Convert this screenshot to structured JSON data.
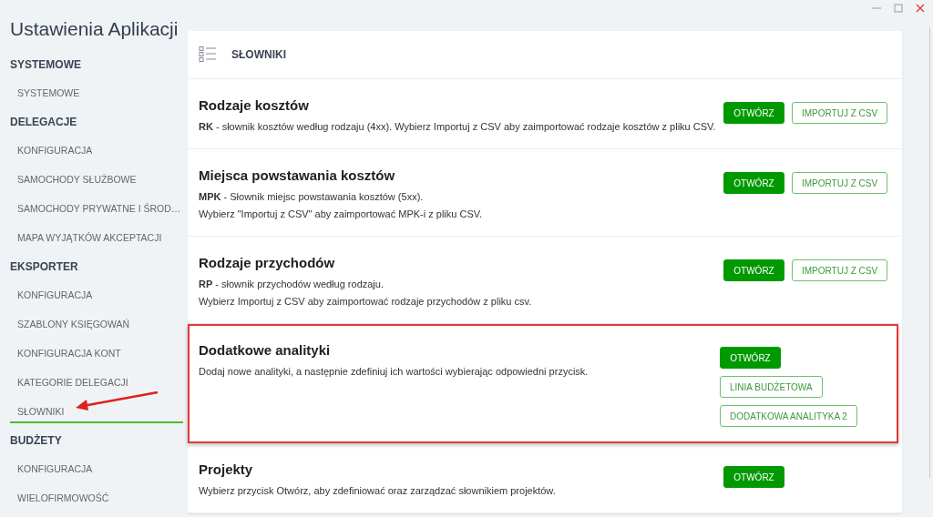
{
  "window": {
    "title": "Ustawienia Aplikacji"
  },
  "sidebar": {
    "groups": [
      {
        "label": "SYSTEMOWE",
        "items": [
          {
            "label": "SYSTEMOWE",
            "selected": false,
            "pointer": false
          }
        ]
      },
      {
        "label": "DELEGACJE",
        "items": [
          {
            "label": "KONFIGURACJA",
            "selected": false,
            "pointer": false
          },
          {
            "label": "SAMOCHODY SŁUŻBOWE",
            "selected": false,
            "pointer": false
          },
          {
            "label": "SAMOCHODY PRYWATNE I ŚROD…",
            "selected": false,
            "pointer": false
          },
          {
            "label": "MAPA WYJĄTKÓW AKCEPTACJI",
            "selected": false,
            "pointer": false
          }
        ]
      },
      {
        "label": "EKSPORTER",
        "items": [
          {
            "label": "KONFIGURACJA",
            "selected": false,
            "pointer": false
          },
          {
            "label": "SZABLONY KSIĘGOWAŃ",
            "selected": false,
            "pointer": false
          },
          {
            "label": "KONFIGURACJA KONT",
            "selected": false,
            "pointer": false
          },
          {
            "label": "KATEGORIE DELEGACJI",
            "selected": false,
            "pointer": false
          },
          {
            "label": "SŁOWNIKI",
            "selected": true,
            "pointer": true
          }
        ]
      },
      {
        "label": "BUDŻETY",
        "items": [
          {
            "label": "KONFIGURACJA",
            "selected": false,
            "pointer": false
          },
          {
            "label": "WIELOFIRMOWOŚĆ",
            "selected": false,
            "pointer": false
          }
        ]
      }
    ]
  },
  "panel": {
    "title": "SŁOWNIKI",
    "sections": [
      {
        "title": "Rodzaje kosztów",
        "lines": [
          "**RK** - słownik kosztów według rodzaju (4xx). Wybierz Importuj z CSV aby zaimportować rodzaje kosztów z pliku CSV."
        ],
        "highlighted": false,
        "buttons": [
          {
            "label": "OTWÓRZ",
            "kind": "primary"
          },
          {
            "label": "IMPORTUJ Z CSV",
            "kind": "outline"
          }
        ]
      },
      {
        "title": "Miejsca powstawania kosztów",
        "lines": [
          "**MPK** - Słownik miejsc powstawania kosztów (5xx).",
          "Wybierz \"Importuj z CSV\" aby zaimportować MPK-i z pliku CSV."
        ],
        "highlighted": false,
        "buttons": [
          {
            "label": "OTWÓRZ",
            "kind": "primary"
          },
          {
            "label": "IMPORTUJ Z CSV",
            "kind": "outline"
          }
        ]
      },
      {
        "title": "Rodzaje przychodów",
        "lines": [
          "**RP** - słownik przychodów według rodzaju.",
          "Wybierz Importuj z CSV aby zaimportować rodzaje przychodów z pliku csv."
        ],
        "highlighted": false,
        "buttons": [
          {
            "label": "OTWÓRZ",
            "kind": "primary"
          },
          {
            "label": "IMPORTUJ Z CSV",
            "kind": "outline"
          }
        ]
      },
      {
        "title": "Dodatkowe analityki",
        "lines": [
          "Dodaj nowe analityki, a następnie zdefiniuj ich wartości wybierając odpowiedni przycisk."
        ],
        "highlighted": true,
        "buttons": [
          {
            "label": "OTWÓRZ",
            "kind": "primary"
          },
          {
            "label": "LINIA BUDŻETOWA",
            "kind": "outline"
          },
          {
            "label": "DODATKOWA ANALITYKA 2",
            "kind": "outline"
          }
        ]
      },
      {
        "title": "Projekty",
        "lines": [
          "Wybierz przycisk Otwórz, aby zdefiniować oraz zarządzać słownikiem projektów."
        ],
        "highlighted": false,
        "buttons": [
          {
            "label": "OTWÓRZ",
            "kind": "primary"
          }
        ]
      }
    ]
  }
}
